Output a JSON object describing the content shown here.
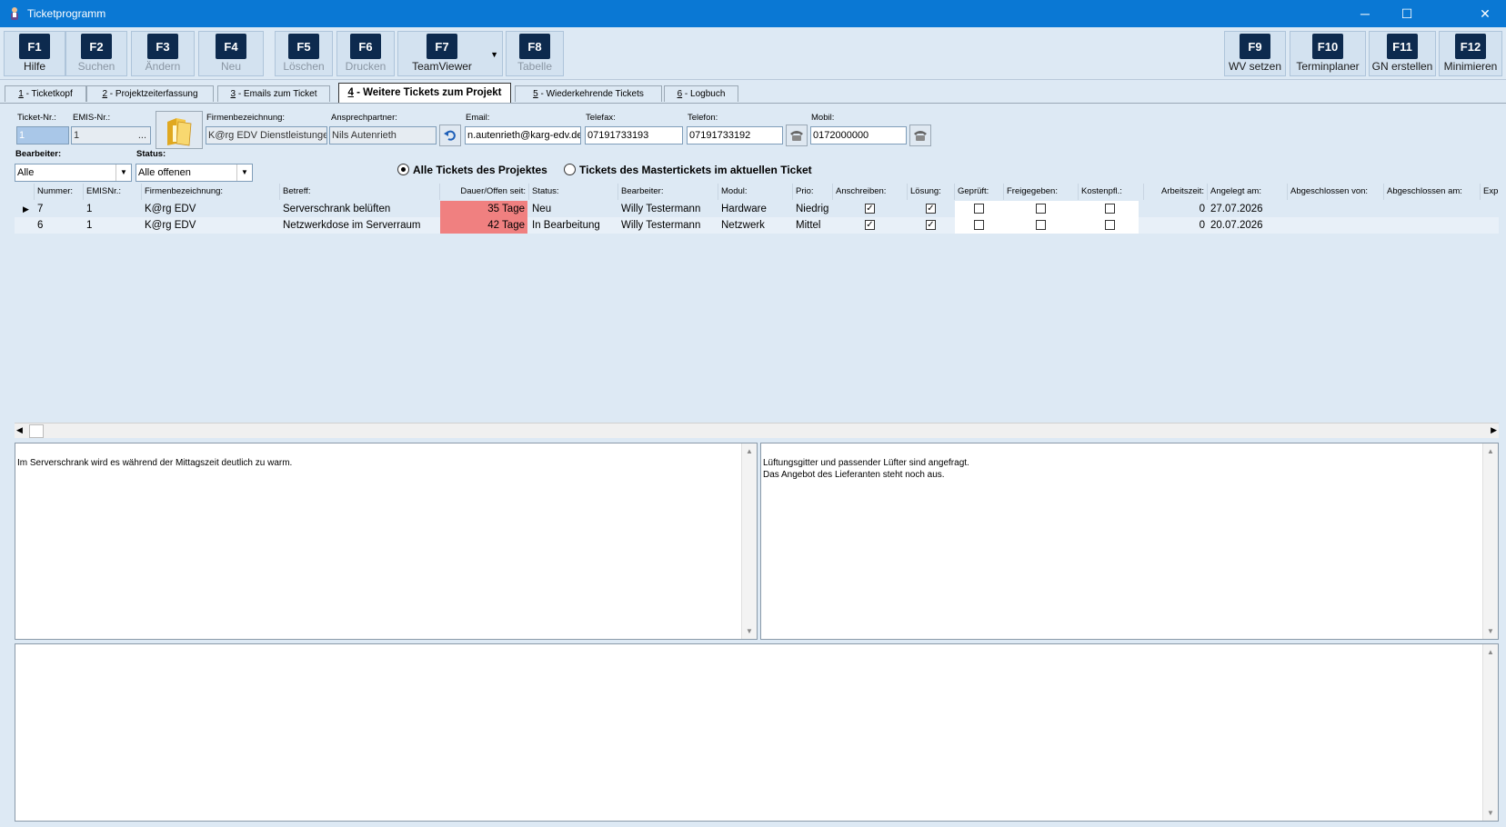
{
  "window": {
    "title": "Ticketprogramm",
    "minimize": "─",
    "maximize": "☐",
    "close": "✕"
  },
  "toolbar": {
    "left": [
      {
        "key": "F1",
        "label": "Hilfe"
      },
      {
        "key": "F2",
        "label": "Suchen"
      },
      {
        "key": "F3",
        "label": "Ändern"
      },
      {
        "key": "F4",
        "label": "Neu"
      },
      {
        "key": "F5",
        "label": "Löschen"
      },
      {
        "key": "F6",
        "label": "Drucken"
      },
      {
        "key": "F7",
        "label": "TeamViewer"
      },
      {
        "key": "F8",
        "label": "Tabelle"
      }
    ],
    "right": [
      {
        "key": "F9",
        "label": "WV setzen"
      },
      {
        "key": "F10",
        "label": "Terminplaner"
      },
      {
        "key": "F11",
        "label": "GN erstellen"
      },
      {
        "key": "F12",
        "label": "Minimieren"
      }
    ]
  },
  "tabs": [
    {
      "num": "1",
      "label": " - Ticketkopf"
    },
    {
      "num": "2",
      "label": " - Projektzeiterfassung"
    },
    {
      "num": "3",
      "label": " - Emails zum Ticket"
    },
    {
      "num": "4",
      "label": " - Weitere Tickets zum Projekt"
    },
    {
      "num": "5",
      "label": " - Wiederkehrende Tickets"
    },
    {
      "num": "6",
      "label": " - Logbuch"
    }
  ],
  "header": {
    "ticket_nr_label": "Ticket-Nr.:",
    "ticket_nr": "1",
    "emis_label": "EMIS-Nr.:",
    "emis": "1",
    "emis_btn": "...",
    "firma_label": "Firmenbezeichnung:",
    "firma": "K@rg EDV Dienstleistungen",
    "ansprech_label": "Ansprechpartner:",
    "ansprech": "Nils Autenrieth",
    "email_label": "Email:",
    "email": "n.autenrieth@karg-edv.de",
    "telefax_label": "Telefax:",
    "telefax": "07191733193",
    "telefon_label": "Telefon:",
    "telefon": "07191733192",
    "mobil_label": "Mobil:",
    "mobil": "0172000000"
  },
  "filters": {
    "bearbeiter_label": "Bearbeiter:",
    "bearbeiter": "Alle",
    "status_label": "Status:",
    "status": "Alle offenen",
    "radio_all": "Alle Tickets des Projektes",
    "radio_master": "Tickets des Mastertickets im aktuellen Ticket"
  },
  "grid": {
    "columns": [
      "Nummer:",
      "EMISNr.:",
      "Firmenbezeichnung:",
      "Betreff:",
      "Dauer/Offen seit:",
      "Status:",
      "Bearbeiter:",
      "Modul:",
      "Prio:",
      "Anschreiben:",
      "Lösung:",
      "Geprüft:",
      "Freigegeben:",
      "Kostenpfl.:",
      "Arbeitszeit:",
      "Angelegt am:",
      "Abgeschlossen von:",
      "Abgeschlossen am:",
      "Exp"
    ],
    "rows": [
      {
        "nummer": "7",
        "emis": "1",
        "firma": "K@rg EDV",
        "betreff": "Serverschrank belüften",
        "dauer": "35 Tage",
        "status": "Neu",
        "bearbeiter": "Willy Testermann",
        "modul": "Hardware",
        "prio": "Niedrig",
        "anschreiben": true,
        "loesung": true,
        "geprueft": false,
        "freigegeben": false,
        "kostenpfl": false,
        "arbeitszeit": "0",
        "angelegt": "27.07.2026",
        "abg_von": "",
        "abg_am": ""
      },
      {
        "nummer": "6",
        "emis": "1",
        "firma": "K@rg EDV",
        "betreff": "Netzwerkdose im Serverraum",
        "dauer": "42 Tage",
        "status": "In Bearbeitung",
        "bearbeiter": "Willy Testermann",
        "modul": "Netzwerk",
        "prio": "Mittel",
        "anschreiben": true,
        "loesung": true,
        "geprueft": false,
        "freigegeben": false,
        "kostenpfl": false,
        "arbeitszeit": "0",
        "angelegt": "20.07.2026",
        "abg_von": "",
        "abg_am": ""
      }
    ],
    "row_pointer": "▶",
    "dauer_color": "#f08080"
  },
  "memos": {
    "left": "Im Serverschrank wird es während der Mittagszeit deutlich zu warm.",
    "right": "Lüftungsgitter und passender Lüfter sind angefragt.\nDas Angebot des Lieferanten steht noch aus.",
    "bottom": ""
  },
  "colors": {
    "titlebar": "#0a78d4",
    "fkey": "#0d2a4e",
    "background": "#dde9f4"
  }
}
